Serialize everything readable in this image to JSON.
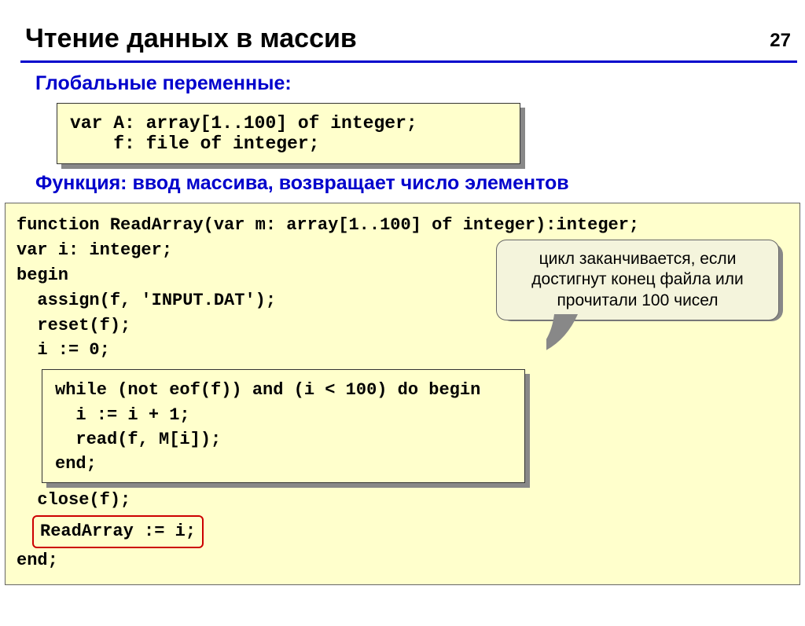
{
  "page_number": "27",
  "title": "Чтение данных в массив",
  "section1_label": "Глобальные переменные:",
  "global_vars_code": "var A: array[1..100] of integer;\n    f: file of integer;",
  "section2_label": "Функция: ввод массива, возвращает число элементов",
  "func_code_top": "function ReadArray(var m: array[1..100] of integer):integer;\nvar i: integer;\nbegin\n  assign(f, 'INPUT.DAT');\n  reset(f);\n  i := 0;",
  "while_code": "while (not eof(f)) and (i < 100) do begin\n  i := i + 1;\n  read(f, M[i]);\nend;",
  "close_line": "  close(f);",
  "result_line": "ReadArray := i;",
  "end_line": "end;",
  "callout_text": "цикл заканчивается, если достигнут конец файла или прочитали 100 чисел"
}
